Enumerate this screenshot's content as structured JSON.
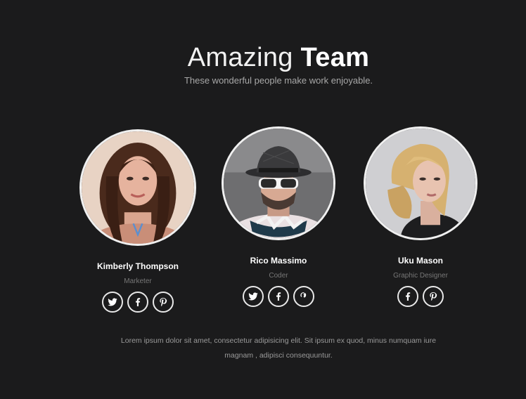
{
  "header": {
    "title_light": "Amazing",
    "title_bold": "Team",
    "subtitle": "These wonderful people make work enjoyable."
  },
  "members": [
    {
      "name": "Kimberly Thompson",
      "role": "Marketer",
      "photo": "portrait-woman-brunette",
      "socials": [
        "twitter-icon",
        "facebook-icon",
        "pinterest-icon"
      ]
    },
    {
      "name": "Rico Massimo",
      "role": "Coder",
      "photo": "portrait-man-hat-sunglasses",
      "socials": [
        "twitter-icon",
        "facebook-icon",
        "pinterest-icon"
      ]
    },
    {
      "name": "Uku Mason",
      "role": "Graphic Designer",
      "photo": "portrait-woman-blonde",
      "socials": [
        "facebook-icon",
        "pinterest-icon"
      ]
    }
  ],
  "footer": {
    "line1": "Lorem ipsum dolor sit amet, consectetur adipisicing elit. Sit ipsum ex quod, minus numquam iure",
    "line2": "magnam , adipisci consequuntur."
  },
  "colors": {
    "background": "#1b1b1c",
    "ring": "#f0f0f0",
    "muted_text": "#9a9a9a"
  }
}
